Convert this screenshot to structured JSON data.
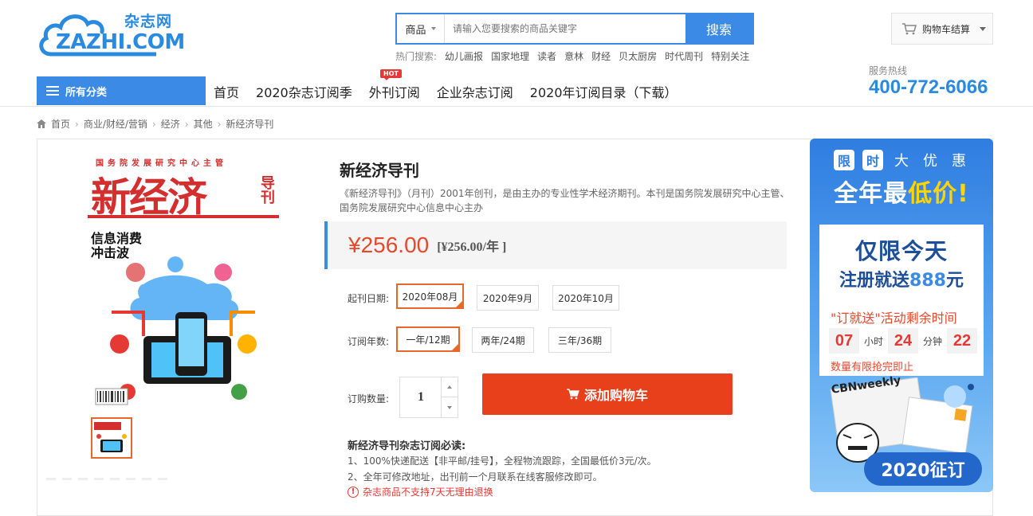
{
  "header": {
    "logo_cn": "杂志网",
    "logo_en": "ZAZHI.COM",
    "search": {
      "category": "商品",
      "placeholder": "请输入您要搜索的商品关键字",
      "button": "搜索"
    },
    "hot_label": "热门搜索:",
    "hot_words": [
      "幼儿画报",
      "国家地理",
      "读者",
      "意林",
      "财经",
      "贝太厨房",
      "时代周刊",
      "特别关注"
    ],
    "cart": "购物车结算",
    "hotline_label": "服务热线",
    "hotline": "400-772-6066"
  },
  "nav": {
    "all_categories": "所有分类",
    "items": [
      "首页",
      "2020杂志订阅季",
      "外刊订阅",
      "企业杂志订阅",
      "2020年订阅目录（下载）"
    ],
    "hot_badge": "HOT"
  },
  "breadcrumb": [
    "首页",
    "商业/财经/营销",
    "经济",
    "其他",
    "新经济导刊"
  ],
  "product": {
    "cover_top": "国务院发展研究中心主管",
    "cover_title": "新经济",
    "cover_side": "导刊",
    "cover_headline_1": "信息消费",
    "cover_headline_2": "冲击波",
    "title": "新经济导刊",
    "description": "《新经济导刊》（月刊）2001年创刊，是由主办的专业性学术经济期刊。本刊是国务院发展研究中心主管、国务院发展研究中心信息中心主办",
    "price": "¥256.00",
    "unit_price": "[¥256.00/年 ]",
    "start_label": "起刊日期:",
    "start_options": [
      "2020年08月",
      "2020年9月",
      "2020年10月"
    ],
    "years_label": "订阅年数:",
    "year_options": [
      "一年/12期",
      "两年/24期",
      "三年/36期"
    ],
    "qty_label": "订购数量:",
    "qty": "1",
    "add_cart": "添加购物车",
    "notice_title": "新经济导刊杂志订阅必读:",
    "notice_1": "1、100%快递配送【非平邮/挂号】，全程物流跟踪，全国最低价3元/次。",
    "notice_2": "2、全年可修改地址，出刊前一个月联系在线客服修改即可。",
    "warning": "杂志商品不支持7天无理由退换"
  },
  "promo": {
    "line1": [
      "限",
      "时",
      "大",
      "优",
      "惠"
    ],
    "line2a": "全年最",
    "line2b": "低价!",
    "card_l1": "仅限今天",
    "card_l2a": "注册就送",
    "card_l2b": "888",
    "card_l2c": "元",
    "card_l3": "\"订就送\"活动剩余时间",
    "hours": "07",
    "hours_unit": "小时",
    "minutes": "24",
    "minutes_unit": "分钟",
    "seconds": "22",
    "card_l4": "数量有限抢完即止",
    "mag_label": "CBNweekly",
    "badge": "2020征订"
  }
}
